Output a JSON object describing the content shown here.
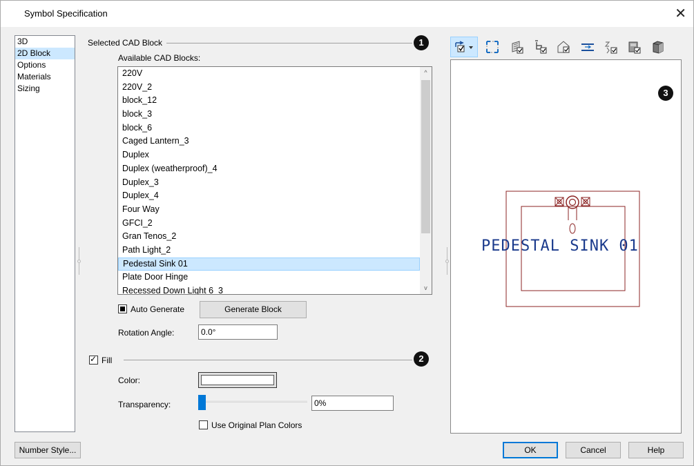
{
  "window": {
    "title": "Symbol Specification",
    "close_glyph": "✕"
  },
  "nav": {
    "items": [
      "3D",
      "2D Block",
      "Options",
      "Materials",
      "Sizing"
    ],
    "selected": "2D Block"
  },
  "cad_block_group": {
    "label": "Selected CAD Block",
    "badge": "1",
    "available_label": "Available CAD Blocks:",
    "items": [
      "220V",
      "220V_2",
      "block_12",
      "block_3",
      "block_6",
      "Caged Lantern_3",
      "Duplex",
      "Duplex (weatherproof)_4",
      "Duplex_3",
      "Duplex_4",
      "Four Way",
      "GFCI_2",
      "Gran Tenos_2",
      "Path Light_2",
      "Pedestal Sink 01",
      "Plate Door Hinge",
      "Recessed Down Light 6_3"
    ],
    "selected_item": "Pedestal Sink 01",
    "scroll_up": "^",
    "scroll_down": "v",
    "auto_generate_label": "Auto Generate",
    "generate_button": "Generate Block",
    "rotation_label": "Rotation Angle:",
    "rotation_value": "0.0°"
  },
  "fill_group": {
    "label": "Fill",
    "badge": "2",
    "checked": true,
    "color_label": "Color:",
    "color_value": "#ffffff",
    "transparency_label": "Transparency:",
    "transparency_value": "0%",
    "transparency_level": 0,
    "use_original_label": "Use Original Plan Colors"
  },
  "preview": {
    "badge": "3",
    "symbol_label": "PEDESTAL SINK 01",
    "line_color": "#8b2323",
    "text_color": "#1a3a8c",
    "toolbar_icons": [
      "orbit-dropdown-icon",
      "fill-window-icon",
      "view-walls-icon",
      "view-furniture-icon",
      "view-house-icon",
      "view-ceiling-icon",
      "view-xyz-icon",
      "view-cabinet-icon",
      "view-solid-icon"
    ]
  },
  "footer": {
    "number_style": "Number Style...",
    "ok": "OK",
    "cancel": "Cancel",
    "help": "Help"
  },
  "colors": {
    "selection": "#cce8ff",
    "accent": "#0078d7",
    "badge": "#111111"
  }
}
